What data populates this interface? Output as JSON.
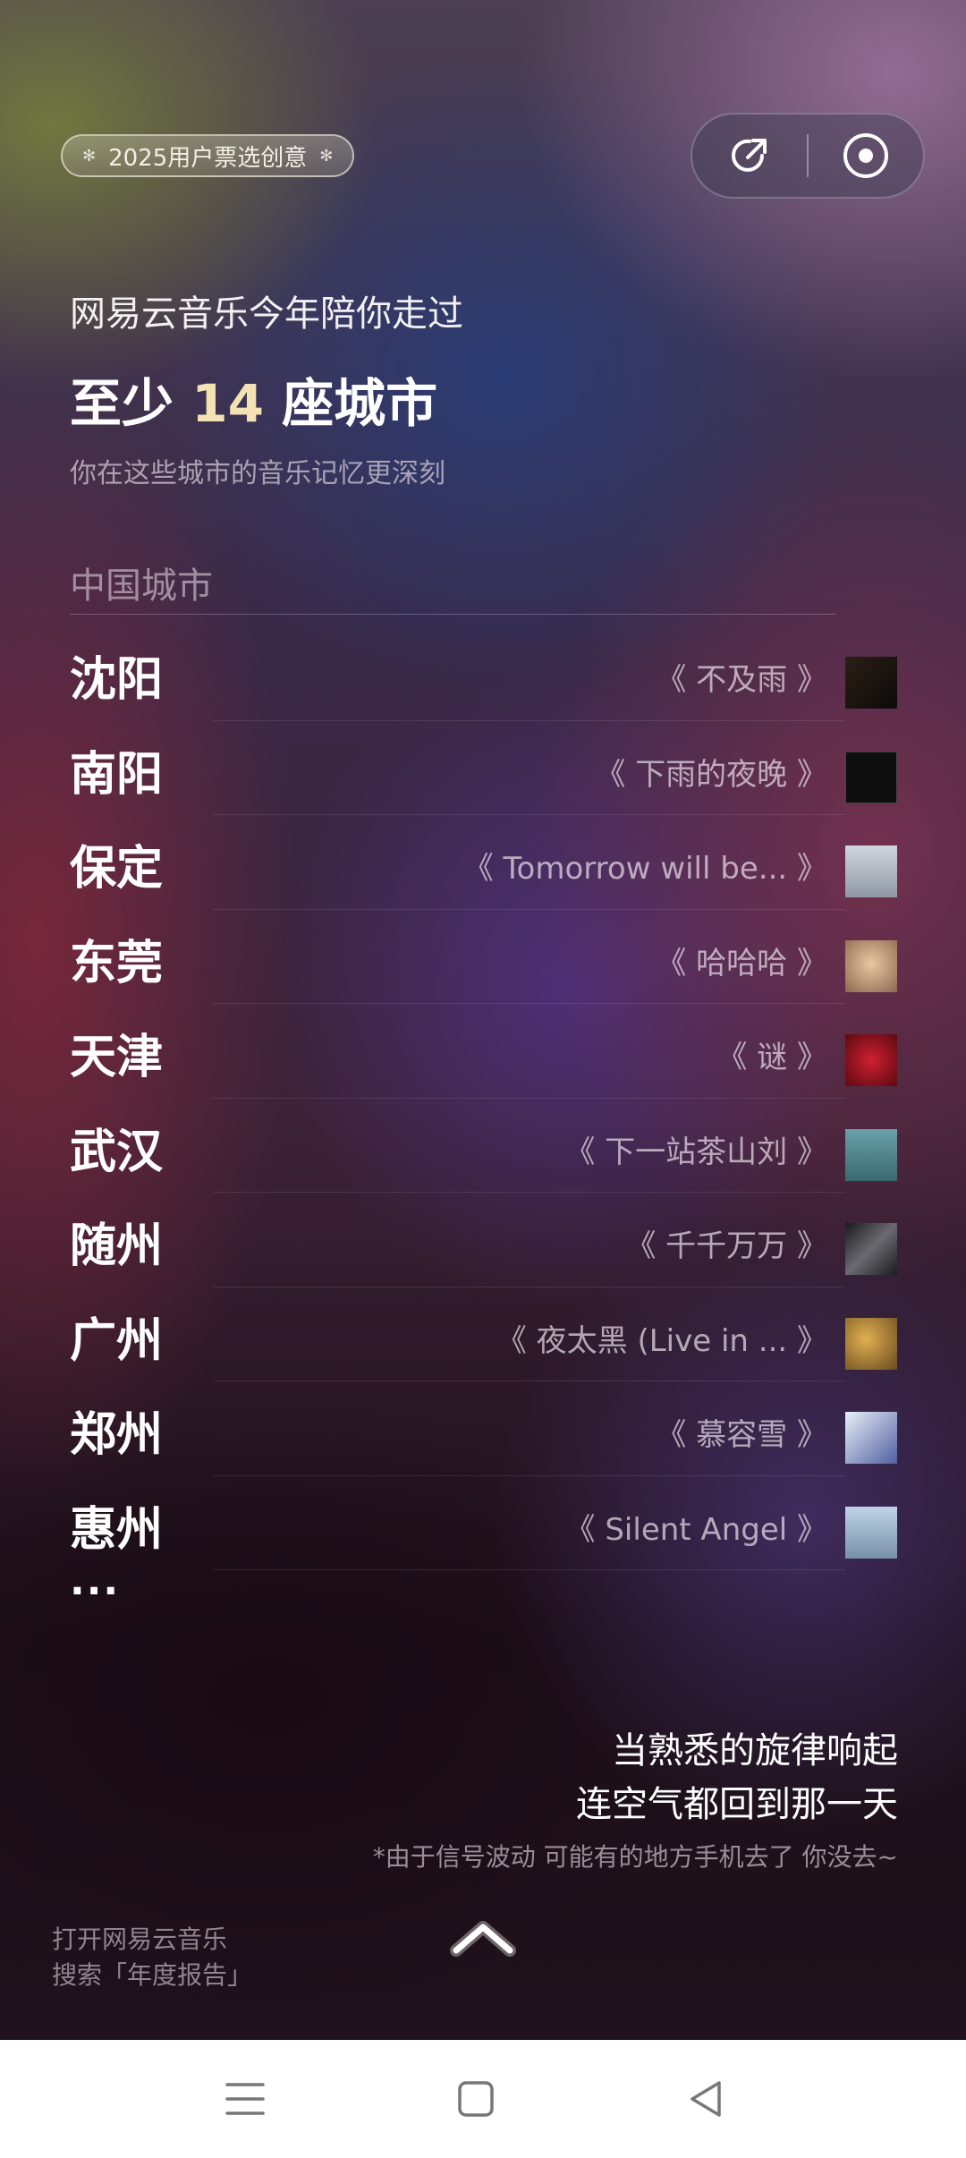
{
  "header": {
    "badge_label": "2025用户票选创意",
    "share_icon": "share-icon",
    "record_icon": "record-icon"
  },
  "intro": {
    "line1": "网易云音乐今年陪你走过",
    "line2_prefix": "至少",
    "city_count": "14",
    "line2_suffix": "座城市",
    "line3": "你在这些城市的音乐记忆更深刻"
  },
  "section": {
    "label": "中国城市"
  },
  "cities": [
    {
      "city": "沈阳",
      "song": "《 不及雨 》",
      "cover_color": "#1a1410"
    },
    {
      "city": "南阳",
      "song": "《 下雨的夜晚 》",
      "cover_color": "#0e0e0e"
    },
    {
      "city": "保定",
      "song": "《 Tomorrow will be... 》",
      "cover_color": "#b8c0c8"
    },
    {
      "city": "东莞",
      "song": "《 哈哈哈 》",
      "cover_color": "#c9a070"
    },
    {
      "city": "天津",
      "song": "《 谜 》",
      "cover_color": "#a01820"
    },
    {
      "city": "武汉",
      "song": "《 下一站茶山刘 》",
      "cover_color": "#5a8a90"
    },
    {
      "city": "随州",
      "song": "《 千千万万 》",
      "cover_color": "#2a2a2e"
    },
    {
      "city": "广州",
      "song": "《 夜太黑 (Live in ... 》",
      "cover_color": "#a07830"
    },
    {
      "city": "郑州",
      "song": "《 慕容雪 》",
      "cover_color": "#7080b0"
    },
    {
      "city": "惠州",
      "song": "《 Silent Angel 》",
      "cover_color": "#9ab0c8"
    }
  ],
  "more": "...",
  "quote": {
    "line1": "当熟悉的旋律响起",
    "line2": "连空气都回到那一天",
    "note": "*由于信号波动 可能有的地方手机去了 你没去~"
  },
  "footer": {
    "hint_line1": "打开网易云音乐",
    "hint_line2": "搜索「年度报告」"
  },
  "colors": {
    "accent_number": "#f3e2b4",
    "nav_bg": "#ffffff"
  },
  "system_nav": {
    "menu_icon": "menu-icon",
    "home_icon": "home-square-icon",
    "back_icon": "back-triangle-icon"
  }
}
